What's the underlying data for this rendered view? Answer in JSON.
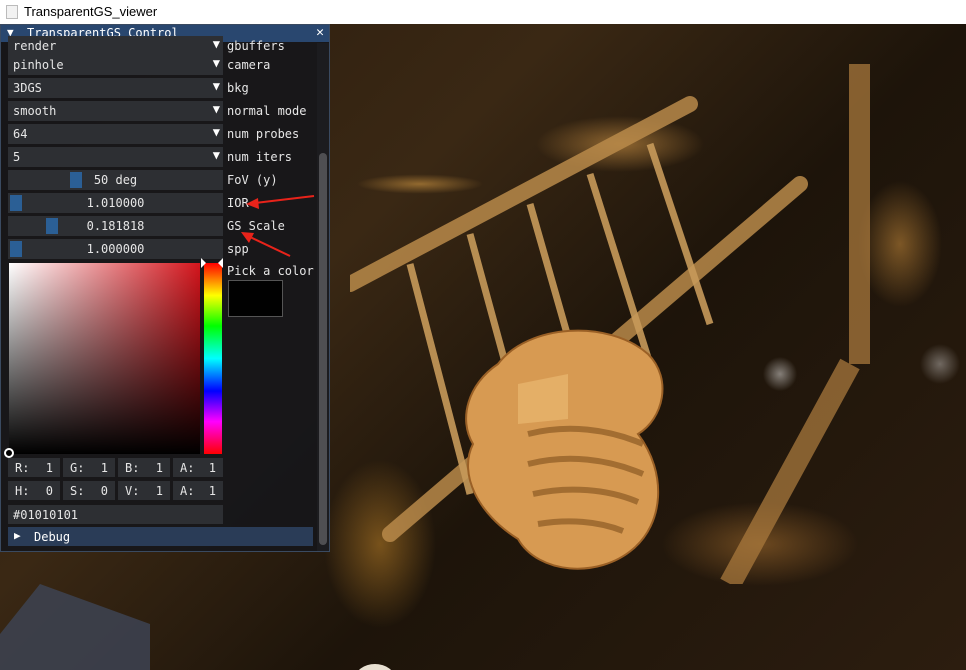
{
  "window": {
    "title": "TransparentGS_viewer"
  },
  "panel": {
    "title": "TransparentGS Control",
    "combos": [
      {
        "value": "render",
        "label": "gbuffers"
      },
      {
        "value": "pinhole",
        "label": "camera"
      },
      {
        "value": "3DGS",
        "label": "bkg"
      },
      {
        "value": "smooth",
        "label": "normal mode"
      },
      {
        "value": "64",
        "label": "num probes"
      },
      {
        "value": "5",
        "label": "num iters"
      }
    ],
    "sliders": [
      {
        "value": "50 deg",
        "label": "FoV (y)",
        "position": 0.3
      },
      {
        "value": "1.010000",
        "label": "IOR",
        "position": 0.0
      },
      {
        "value": "0.181818",
        "label": "GS Scale",
        "position": 0.18
      },
      {
        "value": "1.000000",
        "label": "spp",
        "position": 0.0
      }
    ],
    "color_picker": {
      "label": "Pick a color",
      "swatch_color": "#010101",
      "rgba": [
        {
          "k": "R:",
          "v": "1"
        },
        {
          "k": "G:",
          "v": "1"
        },
        {
          "k": "B:",
          "v": "1"
        },
        {
          "k": "A:",
          "v": "1"
        }
      ],
      "hsva": [
        {
          "k": "H:",
          "v": "0"
        },
        {
          "k": "S:",
          "v": "0"
        },
        {
          "k": "V:",
          "v": "1"
        },
        {
          "k": "A:",
          "v": "1"
        }
      ],
      "hex": "#01010101"
    },
    "debug": {
      "label": "Debug"
    }
  },
  "icons": {
    "collapse": "triangle-down-icon",
    "close": "close-icon",
    "combo_arrow": "triangle-down-icon",
    "expand": "triangle-right-icon"
  },
  "colors": {
    "title_bar": "#29476f",
    "slider_grab": "#2b5f95",
    "frame_bg": "#2d2f33",
    "annotation_arrow": "#e8231a"
  }
}
